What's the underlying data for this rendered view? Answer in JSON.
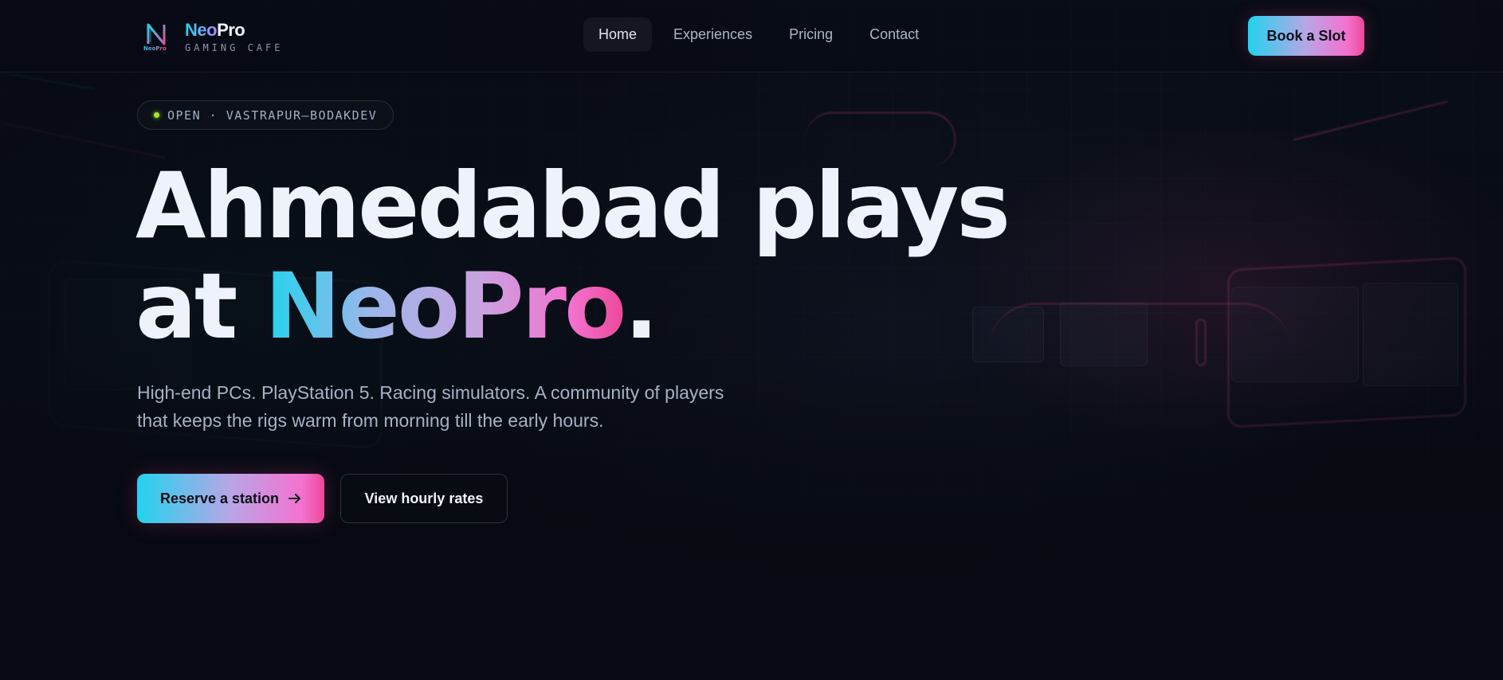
{
  "brand": {
    "name_part1": "Neo",
    "name_part2": "Pro",
    "tagline": "GAMING CAFE",
    "logo_icon": "neopro-logo-icon",
    "logo_small_text": "NeoPro"
  },
  "nav": {
    "items": [
      {
        "label": "Home",
        "active": true
      },
      {
        "label": "Experiences",
        "active": false
      },
      {
        "label": "Pricing",
        "active": false
      },
      {
        "label": "Contact",
        "active": false
      }
    ],
    "cta_label": "Book a Slot"
  },
  "hero": {
    "status": "OPEN · VASTRAPUR–BODAKDEV",
    "status_dot_color": "#a3e635",
    "headline_line1": "Ahmedabad plays",
    "headline_line2_prefix": "at ",
    "headline_brand": "NeoPro",
    "headline_suffix": ".",
    "lede": "High-end PCs. PlayStation 5. Racing simulators. A community of players that keeps the rigs warm from morning till the early hours.",
    "primary_cta": "Reserve a station",
    "primary_cta_icon": "arrow-right-icon",
    "secondary_cta": "View hourly rates"
  },
  "colors": {
    "accent_cyan": "#22d3ee",
    "accent_pink": "#ec4899",
    "background": "#070a12"
  }
}
